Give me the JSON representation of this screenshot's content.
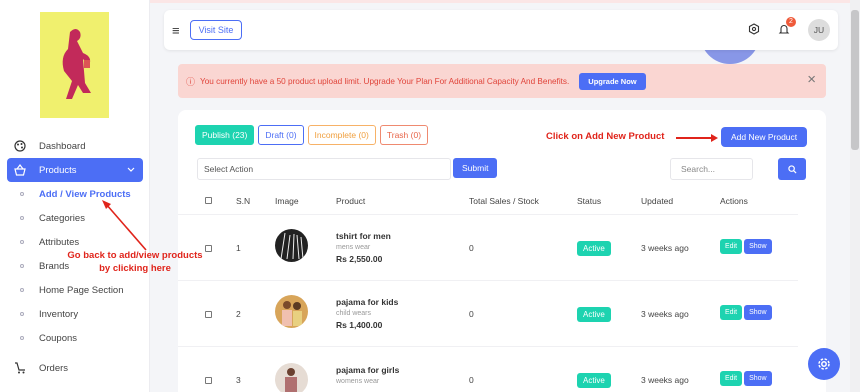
{
  "sidebar": {
    "items": [
      {
        "label": "Dashboard",
        "icon": "palette-icon"
      },
      {
        "label": "Products",
        "icon": "basket-icon",
        "active": true
      },
      {
        "label": "Orders",
        "icon": "cart-icon"
      }
    ],
    "subitems": [
      "Add / View Products",
      "Categories",
      "Attributes",
      "Brands",
      "Home Page Section",
      "Inventory",
      "Coupons"
    ]
  },
  "header": {
    "visit_label": "Visit Site",
    "notif_count": "2",
    "avatar_initials": "JU"
  },
  "alert": {
    "text": "You currently have a 50 product upload limit. Upgrade Your Plan For Additional Capacity And Benefits.",
    "upgrade_label": "Upgrade Now",
    "close": "×"
  },
  "tabs": [
    "Publish (23)",
    "Draft (0)",
    "Incomplete (0)",
    "Trash (0)"
  ],
  "annotations": {
    "add_hint": "Click on Add New Product",
    "back_hint_1": "Go back to add/view products",
    "back_hint_2": "by clicking here"
  },
  "toolbar": {
    "add_label": "Add New Product",
    "select_action": "Select Action",
    "submit_label": "Submit",
    "search_placeholder": "Search..."
  },
  "table": {
    "headers": [
      "S.N",
      "Image",
      "Product",
      "Total Sales / Stock",
      "Status",
      "Updated",
      "Actions"
    ],
    "rows": [
      {
        "sn": "1",
        "name": "tshirt for men",
        "category": "mens wear",
        "price": "Rs 2,550.00",
        "stock": "0",
        "status": "Active",
        "updated": "3 weeks ago",
        "edit": "Edit",
        "show": "Show"
      },
      {
        "sn": "2",
        "name": "pajama for kids",
        "category": "child wears",
        "price": "Rs 1,400.00",
        "stock": "0",
        "status": "Active",
        "updated": "3 weeks ago",
        "edit": "Edit",
        "show": "Show"
      },
      {
        "sn": "3",
        "name": "pajama for girls",
        "category": "womens wear",
        "price": "",
        "stock": "0",
        "status": "Active",
        "updated": "3 weeks ago",
        "edit": "Edit",
        "show": "Show"
      }
    ]
  },
  "colors": {
    "accent": "#4c6ef5",
    "success": "#1dd3b0",
    "alert_bg": "#fad6d2",
    "annotation": "#e0241b"
  }
}
